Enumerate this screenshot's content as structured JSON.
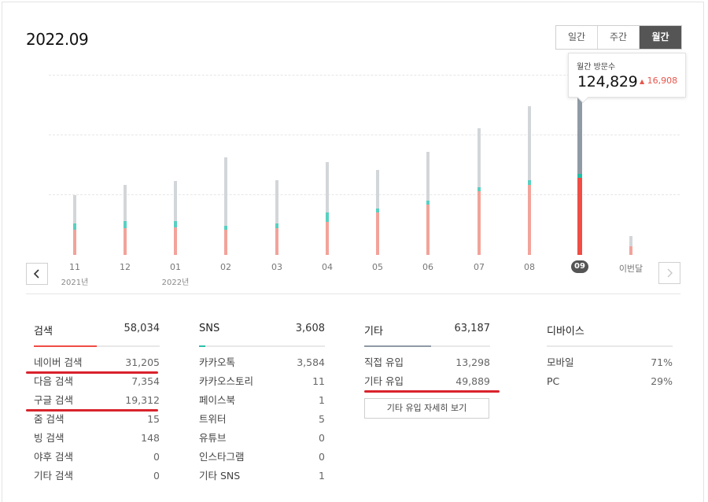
{
  "header": {
    "period_title": "2022.09"
  },
  "period_toggle": {
    "options": [
      {
        "label": "일간",
        "active": false
      },
      {
        "label": "주간",
        "active": false
      },
      {
        "label": "월간",
        "active": true
      }
    ]
  },
  "colors": {
    "search": "#f2a39a",
    "sns": "#58d0c1",
    "other": "#d3d6d9",
    "search_selected": "#ef4d45",
    "other_selected": "#8f9aa5",
    "rule_search": "#ef4d45",
    "rule_sns": "#2bbfab",
    "rule_other": "#8f9aa5"
  },
  "tooltip": {
    "label": "월간 방문수",
    "value": "124,829",
    "delta": "16,908",
    "delta_icon": "up-triangle-icon"
  },
  "chart_data": {
    "type": "bar",
    "stacked": true,
    "categories": [
      "11",
      "12",
      "01",
      "02",
      "03",
      "04",
      "05",
      "06",
      "07",
      "08",
      "09",
      "이번달"
    ],
    "category_sublabels": [
      "2021년",
      "",
      "2022년",
      "",
      "",
      "",
      "",
      "",
      "",
      "",
      "",
      ""
    ],
    "selected_index": 10,
    "grid": true,
    "ylim": [
      0,
      150000
    ],
    "series": [
      {
        "values": [
          20800,
          22500,
          23000,
          21000,
          22300,
          27500,
          35400,
          41600,
          53000,
          58500,
          64000,
          7000
        ]
      },
      {
        "values": [
          5500,
          5500,
          5000,
          3500,
          4000,
          8000,
          3500,
          3500,
          3500,
          3500,
          3500,
          0
        ]
      },
      {
        "values": [
          23500,
          30000,
          33500,
          56500,
          36000,
          42000,
          32000,
          41000,
          49000,
          61500,
          70500,
          8500
        ]
      }
    ]
  },
  "panels": [
    {
      "title": "검색",
      "total": "58,034",
      "fill": 0.5,
      "items": [
        {
          "label": "네이버 검색",
          "value": "31,205"
        },
        {
          "label": "다음 검색",
          "value": "7,354"
        },
        {
          "label": "구글 검색",
          "value": "19,312"
        },
        {
          "label": "줌 검색",
          "value": "15"
        },
        {
          "label": "빙 검색",
          "value": "148"
        },
        {
          "label": "야후 검색",
          "value": "0"
        },
        {
          "label": "기타 검색",
          "value": "0"
        }
      ]
    },
    {
      "title": "SNS",
      "total": "3,608",
      "fill": 0.05,
      "items": [
        {
          "label": "카카오톡",
          "value": "3,584"
        },
        {
          "label": "카카오스토리",
          "value": "11"
        },
        {
          "label": "페이스북",
          "value": "1"
        },
        {
          "label": "트위터",
          "value": "5"
        },
        {
          "label": "유튜브",
          "value": "0"
        },
        {
          "label": "인스타그램",
          "value": "0"
        },
        {
          "label": "기타 SNS",
          "value": "1"
        }
      ]
    },
    {
      "title": "기타",
      "total": "63,187",
      "fill": 0.53,
      "items": [
        {
          "label": "직접 유입",
          "value": "13,298"
        },
        {
          "label": "기타 유입",
          "value": "49,889"
        }
      ],
      "button": "기타 유입 자세히 보기"
    },
    {
      "title": "디바이스",
      "total": "",
      "fill": 0,
      "items": [
        {
          "label": "모바일",
          "value": "71%"
        },
        {
          "label": "PC",
          "value": "29%"
        }
      ]
    }
  ]
}
